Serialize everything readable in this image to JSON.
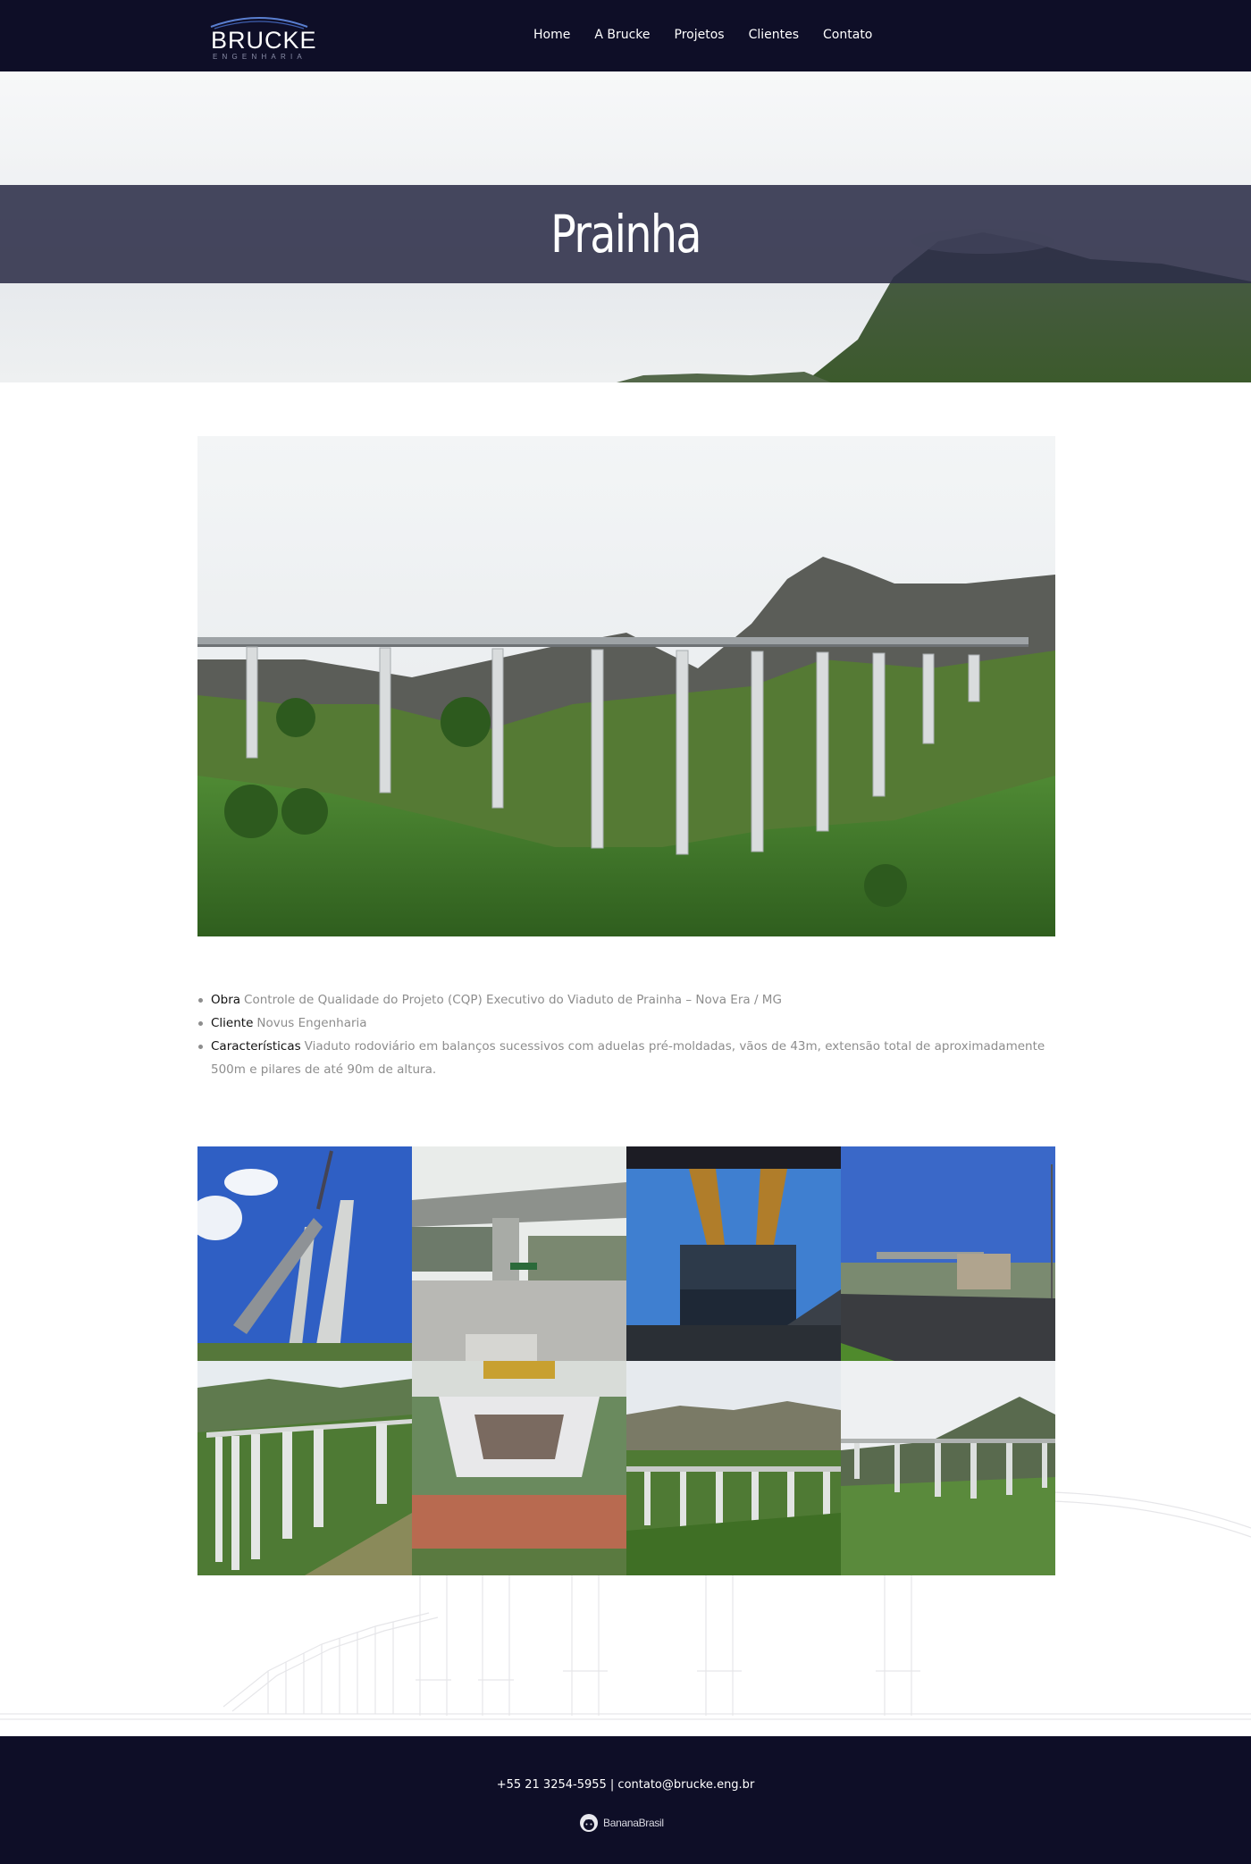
{
  "header": {
    "logo_text": "BRUCKE",
    "logo_subtext": "ENGENHARIA",
    "nav": [
      "Home",
      "A Brucke",
      "Projetos",
      "Clientes",
      "Contato"
    ]
  },
  "hero": {
    "title": "Prainha"
  },
  "details": [
    {
      "label": "Obra",
      "value": "Controle de Qualidade do Projeto (CQP) Executivo do Viaduto de Prainha – Nova Era / MG"
    },
    {
      "label": "Cliente",
      "value": "Novus Engenharia"
    },
    {
      "label": "Características",
      "value": "Viaduto rodoviário em balanços sucessivos com aduelas pré-moldadas, vãos de 43m, extensão total de aproximadamente 500m e pilares de até 90m de altura."
    }
  ],
  "gallery": {
    "count": 8,
    "items": [
      "pier-crane-photo",
      "overpass-highway-photo",
      "launching-gantry-photo",
      "road-overpass-photo",
      "viaduct-hillside-photo",
      "segment-lift-photo",
      "viaduct-valley-photo",
      "viaduct-mountain-photo"
    ]
  },
  "footer": {
    "contact": "+55 21 3254-5955 | contato@brucke.eng.br",
    "credit": "BananaBrasil"
  },
  "colors": {
    "header_bg": "#0e0e27",
    "footer_bg": "#0e0e27",
    "hero_band": "#2c2e48",
    "text_muted": "#8d8d8d"
  }
}
